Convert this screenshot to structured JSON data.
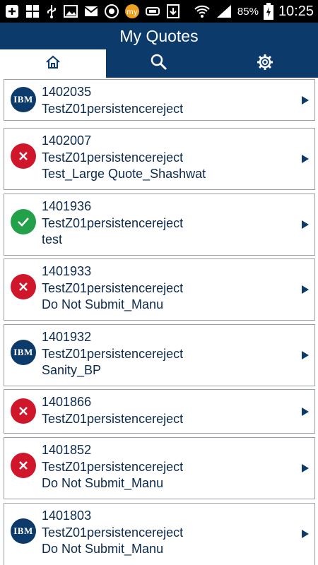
{
  "status_bar": {
    "battery_percent": "85%",
    "time": "10:25",
    "icons_left": [
      "add-icon",
      "app-grid-icon",
      "usb-icon",
      "image-icon",
      "gmail-icon",
      "app-icon",
      "my-app-icon",
      "storage-icon",
      "download-icon"
    ],
    "icons_right": [
      "wifi-icon",
      "signal-icon",
      "battery-charging-icon"
    ]
  },
  "header": {
    "title": "My Quotes"
  },
  "tabs": [
    {
      "name": "home",
      "icon": "home-icon",
      "active": true
    },
    {
      "name": "search",
      "icon": "search-icon",
      "active": false
    },
    {
      "name": "settings",
      "icon": "gear-icon",
      "active": false
    }
  ],
  "quotes": [
    {
      "id": "1402035",
      "name": "TestZ01persistencereject",
      "desc": "",
      "status": "ibm"
    },
    {
      "id": "1402007",
      "name": "TestZ01persistencereject",
      "desc": "Test_Large Quote_Shashwat",
      "status": "reject"
    },
    {
      "id": "1401936",
      "name": "TestZ01persistencereject",
      "desc": "test",
      "status": "ok"
    },
    {
      "id": "1401933",
      "name": "TestZ01persistencereject",
      "desc": "Do Not Submit_Manu",
      "status": "reject"
    },
    {
      "id": "1401932",
      "name": "TestZ01persistencereject",
      "desc": "Sanity_BP",
      "status": "ibm"
    },
    {
      "id": "1401866",
      "name": "TestZ01persistencereject",
      "desc": "",
      "status": "reject"
    },
    {
      "id": "1401852",
      "name": "TestZ01persistencereject",
      "desc": "Do Not Submit_Manu",
      "status": "reject"
    },
    {
      "id": "1401803",
      "name": "TestZ01persistencereject",
      "desc": "Do Not Submit_Manu",
      "status": "ibm"
    }
  ],
  "ibm_logo_text": "IBM",
  "colors": {
    "brand": "#0c3a6b",
    "reject": "#d0162b",
    "approved": "#22a04a"
  }
}
